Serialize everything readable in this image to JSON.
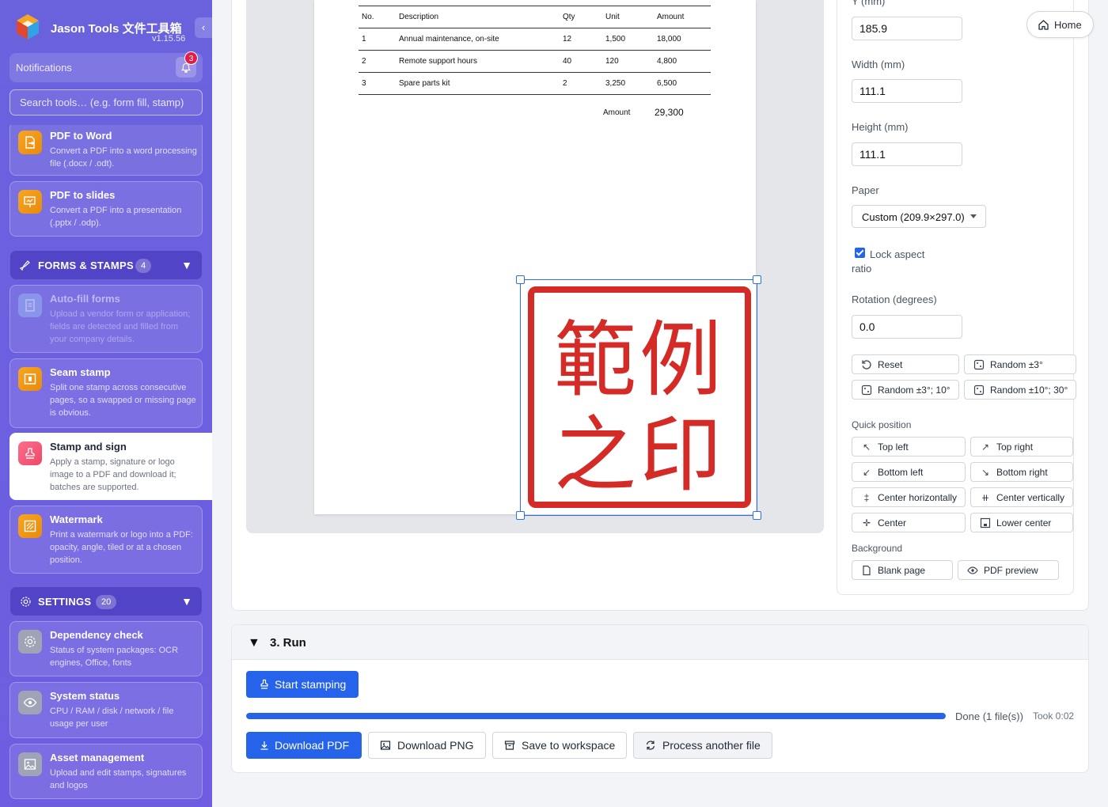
{
  "app": {
    "name": "Jason Tools 文件工具箱",
    "version": "v1.15.56"
  },
  "notifications": {
    "label": "Notifications",
    "count": "3"
  },
  "search": {
    "placeholder": "Search tools… (e.g. form fill, stamp)"
  },
  "sidebar": {
    "convert_items": [
      {
        "title": "PDF to Word",
        "desc": "Convert a PDF into a word processing file (.docx / .odt)."
      },
      {
        "title": "PDF to slides",
        "desc": "Convert a PDF into a presentation (.pptx / .odp)."
      }
    ],
    "forms_section": {
      "label": "FORMS & STAMPS",
      "count": "4"
    },
    "forms_items": [
      {
        "title": "Auto-fill forms",
        "desc": "Upload a vendor form or application; fields are detected and filled from your company details."
      },
      {
        "title": "Seam stamp",
        "desc": "Split one stamp across consecutive pages, so a swapped or missing page is obvious."
      },
      {
        "title": "Stamp and sign",
        "desc": "Apply a stamp, signature or logo image to a PDF and download it; batches are supported."
      },
      {
        "title": "Watermark",
        "desc": "Print a watermark or logo into a PDF: opacity, angle, tiled or at a chosen position."
      }
    ],
    "settings_section": {
      "label": "SETTINGS",
      "count": "20"
    },
    "settings_items": [
      {
        "title": "Dependency check",
        "desc": "Status of system packages: OCR engines, Office, fonts"
      },
      {
        "title": "System status",
        "desc": "CPU / RAM / disk / network / file usage per user"
      },
      {
        "title": "Asset management",
        "desc": "Upload and edit stamps, signatures and logos"
      }
    ]
  },
  "invoice": {
    "headers": [
      "No.",
      "Description",
      "Qty",
      "Unit",
      "Amount"
    ],
    "rows": [
      [
        "1",
        "Annual maintenance, on-site",
        "12",
        "1,500",
        "18,000"
      ],
      [
        "2",
        "Remote support hours",
        "40",
        "120",
        "4,800"
      ],
      [
        "3",
        "Spare parts kit",
        "2",
        "3,250",
        "6,500"
      ]
    ],
    "total_label": "Amount",
    "total_value": "29,300"
  },
  "stamp": {
    "line1": "範例",
    "line2": "之印",
    "color": "#d52b27"
  },
  "settings": {
    "y_label": "Y (mm)",
    "y_value": "185.9",
    "width_label": "Width (mm)",
    "width_value": "111.1",
    "height_label": "Height (mm)",
    "height_value": "111.1",
    "paper_label": "Paper",
    "paper_value": "Custom (209.9×297.0)",
    "lock_label": "Lock aspect",
    "lock_label2": "ratio",
    "rotation_label": "Rotation (degrees)",
    "rotation_value": "0.0",
    "rotation_buttons": [
      "Reset",
      "Random ±3°",
      "Random ±3°; 10°",
      "Random ±10°; 30°"
    ],
    "quick_label": "Quick position",
    "quick_buttons": [
      "Top left",
      "Top right",
      "Bottom left",
      "Bottom right",
      "Center horizontally",
      "Center vertically",
      "Center",
      "Lower center"
    ],
    "background_label": "Background",
    "background_buttons": [
      "Blank page",
      "PDF preview"
    ]
  },
  "home": {
    "label": "Home"
  },
  "run": {
    "title": "3. Run",
    "start_label": "Start stamping",
    "progress": 100,
    "done_text": "Done (1 file(s))",
    "took_text": "Took 0:02",
    "download_pdf": "Download PDF",
    "download_png": "Download PNG",
    "save_workspace": "Save to workspace",
    "process_another": "Process another file"
  },
  "colors": {
    "accent": "#2563eb",
    "sidebar": "#6a62dd",
    "badge": "#e11d48"
  }
}
